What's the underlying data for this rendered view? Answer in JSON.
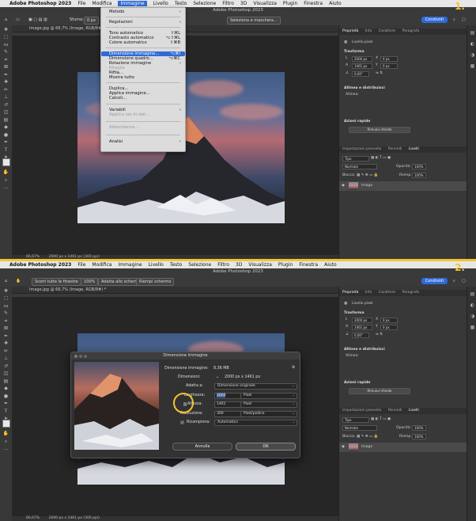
{
  "step1": {
    "badge": "1.",
    "menubar": {
      "app": "Adobe Photoshop 2023",
      "items": [
        "File",
        "Modifica",
        "Immagine",
        "Livello",
        "Testo",
        "Selezione",
        "Filtro",
        "3D",
        "Visualizza",
        "Plugin",
        "Finestra",
        "Aiuto"
      ],
      "active": "Immagine"
    },
    "window_title": "Adobe Photoshop 2023",
    "optionbar": {
      "sfuma_label": "Sfuma:",
      "sfuma_value": "0 px",
      "select_mask": "Seleziona e maschera...",
      "share": "Condividi"
    },
    "doc_tab": "Image.jpg @ 66,7% (Image, RGB/8#) *",
    "status": {
      "zoom": "66,67%",
      "size": "2000 px x 1461 px (300 ppi)"
    },
    "menu": {
      "metodo": "Metodo",
      "regolazioni": "Regolazioni",
      "tono": "Tono automatico",
      "tono_sc": "⇧⌘L",
      "contrasto": "Contrasto automatico",
      "contrasto_sc": "⌥⇧⌘L",
      "colore": "Colore automatico",
      "colore_sc": "⇧⌘B",
      "dimensione_immagine": "Dimensione immagine...",
      "dimensione_immagine_sc": "⌥⌘I",
      "dimensione_quadro": "Dimensione quadro...",
      "dimensione_quadro_sc": "⌥⌘C",
      "rotazione": "Rotazione immagine",
      "ritaglia": "Ritaglia",
      "rifila": "Rifila...",
      "mostra": "Mostra tutto",
      "duplica": "Duplica...",
      "applica": "Applica immagine...",
      "calcoli": "Calcoli...",
      "variabili": "Variabili",
      "applica_dati": "Applica set di dati...",
      "abbondanza": "Abbondanza...",
      "analisi": "Analisi"
    },
    "panel": {
      "tabs": [
        "Proprietà",
        "Info",
        "Carattere",
        "Paragrafo"
      ],
      "pixel_layer": "Livello pixel",
      "trasforma": "Trasforma",
      "w": "2000 px",
      "h": "1461 px",
      "x": "0 px",
      "y": "0 px",
      "angle": "0,00°",
      "allinea": "Allinea e distribuisci",
      "allinea_sub": "Allinea:",
      "azioni": "Azioni rapide",
      "rimuovi": "Rimuovi sfondo",
      "layer_tabs": [
        "Impostazioni pennello",
        "Pennelli",
        "Livelli"
      ],
      "tipo": "Tipo",
      "normale": "Normale",
      "opacita": "Opacità:",
      "opacita_val": "100%",
      "blocca": "Blocca:",
      "riemp": "Riemp.:",
      "riemp_val": "100%",
      "layer_name": "Image"
    }
  },
  "step2": {
    "badge": "2.",
    "menubar": {
      "app": "Adobe Photoshop 2023",
      "items": [
        "File",
        "Modifica",
        "Immagine",
        "Livello",
        "Testo",
        "Selezione",
        "Filtro",
        "3D",
        "Visualizza",
        "Plugin",
        "Finestra",
        "Aiuto"
      ]
    },
    "window_title": "Adobe Photoshop 2023",
    "optionbar": {
      "scroll_all": "Scorri tutte le finestre",
      "zoom": "100%",
      "fit": "Adatta allo schermo",
      "fill": "Riempi schermo",
      "share": "Condividi"
    },
    "doc_tab": "Image.jpg @ 66,7% (Image, RGB/8#) *",
    "status": {
      "zoom": "66,67%",
      "size": "2000 px x 1461 px (300 ppi)"
    },
    "dialog": {
      "title": "Dimensione immagine",
      "dim_immagine_label": "Dimensione immagine:",
      "dim_immagine_val": "8,36 MB",
      "dimensioni_label": "Dimensioni:",
      "dimensioni_val": "2000 px x 1461 px",
      "adatta_label": "Adatta a:",
      "adatta_val": "Dimensione originale",
      "larghezza_label": "Larghezza:",
      "larghezza_val": "2000",
      "larghezza_unit": "Pixel",
      "altezza_label": "Altezza:",
      "altezza_val": "1461",
      "altezza_unit": "Pixel",
      "risoluzione_label": "Risoluzione:",
      "risoluzione_val": "300",
      "risoluzione_unit": "Pixel/pollice",
      "ricampiona_label": "Ricampiona:",
      "ricampiona_val": "Automatico",
      "annulla": "Annulla",
      "ok": "OK"
    },
    "panel": {
      "tabs": [
        "Proprietà",
        "Info",
        "Carattere",
        "Paragrafo"
      ],
      "pixel_layer": "Livello pixel",
      "trasforma": "Trasforma",
      "w": "2000 px",
      "h": "1461 px",
      "x": "0 px",
      "y": "0 px",
      "angle": "0,00°",
      "allinea": "Allinea e distribuisci",
      "allinea_sub": "Allinea:",
      "azioni": "Azioni rapide",
      "rimuovi": "Rimuovi sfondo",
      "layer_tabs": [
        "Impostazioni pennello",
        "Pennelli",
        "Livelli"
      ],
      "tipo": "Tipo",
      "normale": "Normale",
      "opacita": "Opacità:",
      "opacita_val": "100%",
      "blocca": "Blocca:",
      "riemp": "Riemp.:",
      "riemp_val": "100%",
      "layer_name": "Image"
    }
  },
  "colors": {
    "accent": "#2f6bd8",
    "highlight_ring": "#f4c430",
    "ui_dark": "#383838"
  }
}
